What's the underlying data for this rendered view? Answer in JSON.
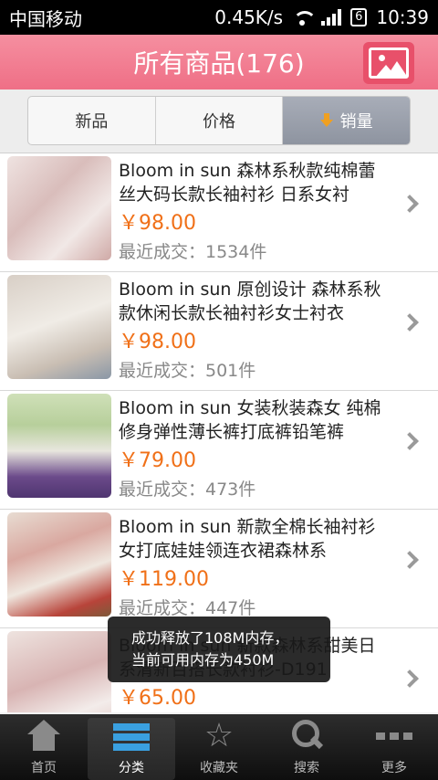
{
  "status": {
    "carrier": "中国移动",
    "speed": "0.45K/s",
    "battery": "6",
    "time": "10:39"
  },
  "header": {
    "title": "所有商品(176)"
  },
  "sort_tabs": [
    {
      "label": "新品"
    },
    {
      "label": "价格"
    },
    {
      "label": "销量"
    }
  ],
  "products": [
    {
      "name": "Bloom in sun 森林系秋款纯棉蕾丝大码长款长袖衬衫 日系女衬",
      "price": "￥98.00",
      "sold": "最近成交：1534件"
    },
    {
      "name": "Bloom in sun 原创设计 森林系秋款休闲长款长袖衬衫女士衬衣",
      "price": "￥98.00",
      "sold": "最近成交：501件"
    },
    {
      "name": "Bloom in sun 女装秋装森女 纯棉修身弹性薄长裤打底裤铅笔裤",
      "price": "￥79.00",
      "sold": "最近成交：473件"
    },
    {
      "name": "Bloom in sun 新款全棉长袖衬衫女打底娃娃领连衣裙森林系",
      "price": "￥119.00",
      "sold": "最近成交：447件"
    },
    {
      "name": "Bloom in sun 新款森林系甜美日系清新百搭长款衬衫-D191",
      "price": "￥65.00",
      "sold": ""
    }
  ],
  "toast": {
    "line1": "成功释放了108M内存，",
    "line2": "当前可用内存为450M"
  },
  "tabbar": [
    {
      "label": "首页"
    },
    {
      "label": "分类"
    },
    {
      "label": "收藏夹"
    },
    {
      "label": "搜索"
    },
    {
      "label": "更多"
    }
  ],
  "colors": {
    "header": "#ef6f86",
    "price": "#f07018",
    "active_tab": "#3aa0e0"
  }
}
